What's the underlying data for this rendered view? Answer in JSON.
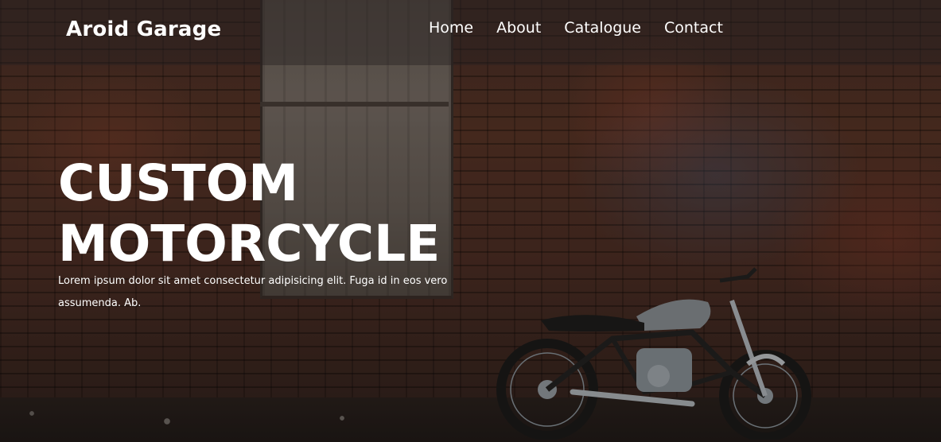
{
  "header": {
    "brand": "Aroid Garage",
    "nav": [
      {
        "label": "Home"
      },
      {
        "label": "About"
      },
      {
        "label": "Catalogue"
      },
      {
        "label": "Contact"
      }
    ]
  },
  "hero": {
    "headline_line1": "CUSTOM",
    "headline_line2": "MOTORCYCLE",
    "description": "Lorem ipsum dolor sit amet consectetur adipisicing elit. Fuga id in eos vero assumenda. Ab."
  },
  "colors": {
    "text": "#ffffff",
    "header_overlay": "rgba(40,34,34,0.45)",
    "brick": "#5a3528"
  },
  "icons": [
    "motorcycle-image"
  ]
}
